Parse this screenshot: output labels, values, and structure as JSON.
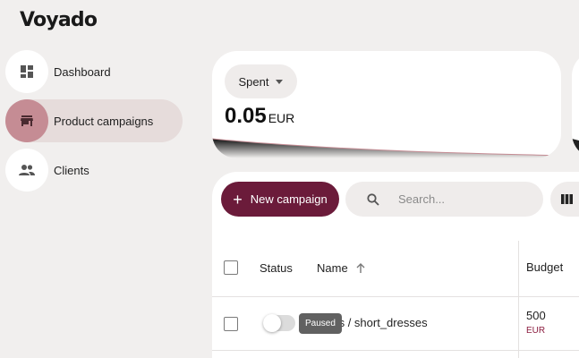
{
  "app": {
    "logo": "Voyado"
  },
  "sidebar": {
    "items": [
      {
        "label": "Dashboard",
        "icon": "dashboard-icon"
      },
      {
        "label": "Product campaigns",
        "icon": "storefront-icon",
        "active": true
      },
      {
        "label": "Clients",
        "icon": "people-icon"
      }
    ]
  },
  "spent_card": {
    "selector_label": "Spent",
    "value": "0.05",
    "currency": "EUR"
  },
  "toolbar": {
    "new_campaign_label": "New campaign",
    "search_placeholder": "Search..."
  },
  "table": {
    "columns": {
      "status": "Status",
      "name": "Name",
      "budget": "Budget"
    },
    "rows": [
      {
        "status_tooltip": "Paused",
        "name": "heels / short_dresses",
        "budget_value": "500",
        "budget_currency": "EUR"
      }
    ]
  },
  "colors": {
    "accent": "#6b1b3a",
    "active_nav_bg": "#e6dcdb",
    "active_nav_icon_bg": "#c58c94",
    "background": "#f1efee"
  }
}
